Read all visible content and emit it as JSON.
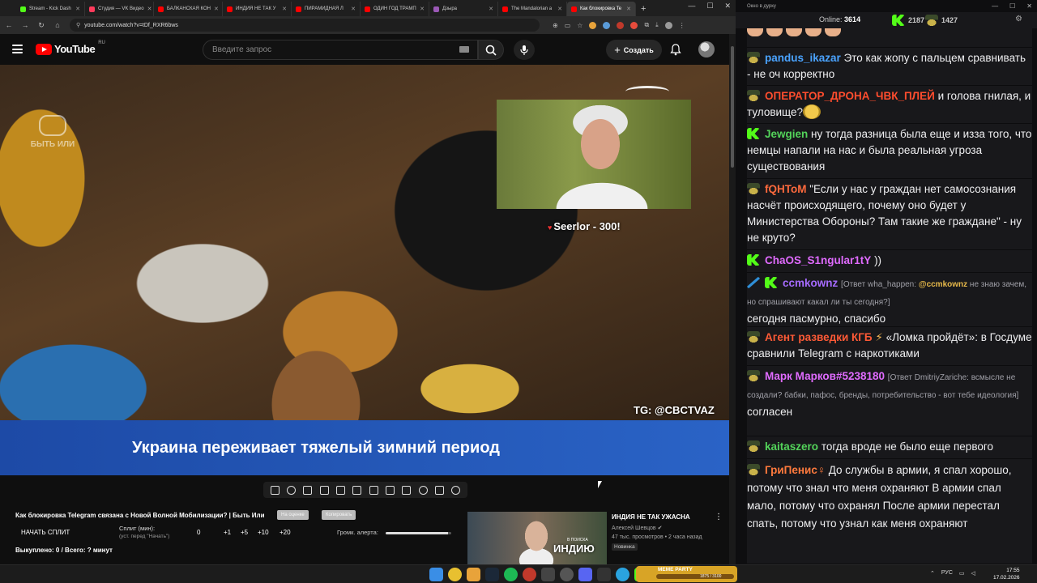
{
  "browser": {
    "tabs": [
      {
        "label": "Stream - Kick Dash",
        "color": "#53fc18"
      },
      {
        "label": "Студия — VK Видео",
        "color": "#ff3b5c"
      },
      {
        "label": "БАЛКАНСКАЯ КОН",
        "color": "#ff0000"
      },
      {
        "label": "ИНДИЯ НЕ ТАК У",
        "color": "#ff0000"
      },
      {
        "label": "ПИРАМИДНАЯ Л",
        "color": "#ff0000"
      },
      {
        "label": "ОДИН ГОД ТРАМП",
        "color": "#ff0000"
      },
      {
        "label": "Дзырa",
        "color": "#9b59b6"
      },
      {
        "label": "The Mandalorian a",
        "color": "#ff0000"
      },
      {
        "label": "Как блокировка Te",
        "color": "#ff0000",
        "active": true
      }
    ],
    "new_tab": "+",
    "url": "youtube.com/watch?v=tDf_RXR6bws"
  },
  "youtube": {
    "logo_text": "YouTube",
    "country": "RU",
    "search_placeholder": "Введите запрос",
    "create_label": "Создать"
  },
  "video": {
    "watermark": "БЫТЬ ИЛИ",
    "pip_alert_name": "Seerlor - 300!",
    "tg_watermark": "TG: @CBCTVAZ",
    "subtitle": "Украина переживает тяжелый зимний период",
    "title": "Как блокировка Telegram связана с Новой Волной Мобилизации? | Быть Или",
    "pill_1": "На оценке",
    "pill_2": "Копировать",
    "start_split": "НАЧАТЬ СПЛИТ",
    "split_label": "Сплит (мин):",
    "split_hint": "(уст. перед \"Начать\")",
    "split_values": [
      "0",
      "+1",
      "+5",
      "+10",
      "+20"
    ],
    "alert_volume_label": "Громк. алерта:",
    "alert_volume": 0.95,
    "bought": "Выкуплено: 0 / Всего: ? минут"
  },
  "recommendation": {
    "title": "ИНДИЯ НЕ ТАК УЖАСНА",
    "channel": "Алексей Шевцов",
    "meta": "47 тыс. просмотров • 2 часа назад",
    "badge": "Новинка",
    "thumb_small": "В ПОИСКА",
    "thumb_text": "ИНДИЮ"
  },
  "chat": {
    "window_title": "Окно в дурку",
    "online_label": "Online:",
    "online_count": "3614",
    "kick_count": "2187",
    "other_count": "1427",
    "messages": [
      {
        "badges": [],
        "user": "",
        "color": "#ffffff",
        "text": "",
        "emojis_only": true
      },
      {
        "badges": [
          "hat"
        ],
        "user": "pandus_ikazar",
        "color": "#4aa3ff",
        "text": "Это как жопу с пальцем сравнивать - не оч корректно"
      },
      {
        "badges": [
          "hat"
        ],
        "user": "ОПЕРАТОР_ДРОНА_ЧВК_ПЛЕЙ",
        "color": "#ff4d2e",
        "text": "и голова гнилая, и туловище?"
      },
      {
        "badges": [
          "kick"
        ],
        "user": "Jewgien",
        "color": "#53d35a",
        "text": "ну тогда разница была еще и изза того, что немцы напали на нас и была реальная угроза существования"
      },
      {
        "badges": [
          "hat"
        ],
        "user": "fQHToM",
        "color": "#ff6a3d",
        "text": "\"Если у нас у граждан нет самосознания насчёт происходящего, почему оно будет у Министерства Обороны? Там такие же граждане\" - ну не круто?"
      },
      {
        "badges": [
          "kick"
        ],
        "user": "ChaOS_S1ngular1tY",
        "color": "#e06bff",
        "text": "))"
      },
      {
        "badges": [
          "sword",
          "kick"
        ],
        "user": "ccmkownz",
        "color": "#a66bff",
        "reply_prefix": "[Ответ wha_happen:",
        "reply_mention": "@ccmkownz",
        "reply_text": "не знаю зачем, но спрашивают какал ли ты сегодня?]",
        "text": "сегодня пасмурно, спасибо"
      },
      {
        "badges": [
          "hat"
        ],
        "user": "Агент разведки КГБ",
        "color": "#ff5a36",
        "text": "«Ломка пройдёт»: в Госдуме сравнили Telegram с наркотиками"
      },
      {
        "badges": [
          "hat"
        ],
        "user": "Марк Марков#5238180",
        "color": "#e06bff",
        "reply_prefix": "[Ответ DmitriyZariche:",
        "reply_mention": "",
        "reply_text": "всмысле не создали? бабки, пафос, бренды, потребительство - вот тебе идеология]",
        "text": "согласен"
      },
      {
        "badges": [
          "hat"
        ],
        "user": "kaitaszero",
        "color": "#53d35a",
        "text": "тогда вроде не было еще первого"
      },
      {
        "badges": [
          "hat"
        ],
        "user": "ГриПенис♀",
        "color": "#ff7a3d",
        "text": "До службы в армии, я спал хорошо, потому что знал что меня охраняют В армии спал мало, потому что охранял После армии перестал спать, потому что узнал как меня охраняют"
      }
    ]
  },
  "taskbar": {
    "meme_party_label": "MEME PARTY",
    "meme_party_progress": "1875 / 3100",
    "lang": "РУС",
    "time": "17:55",
    "date": "17.02.2026"
  }
}
